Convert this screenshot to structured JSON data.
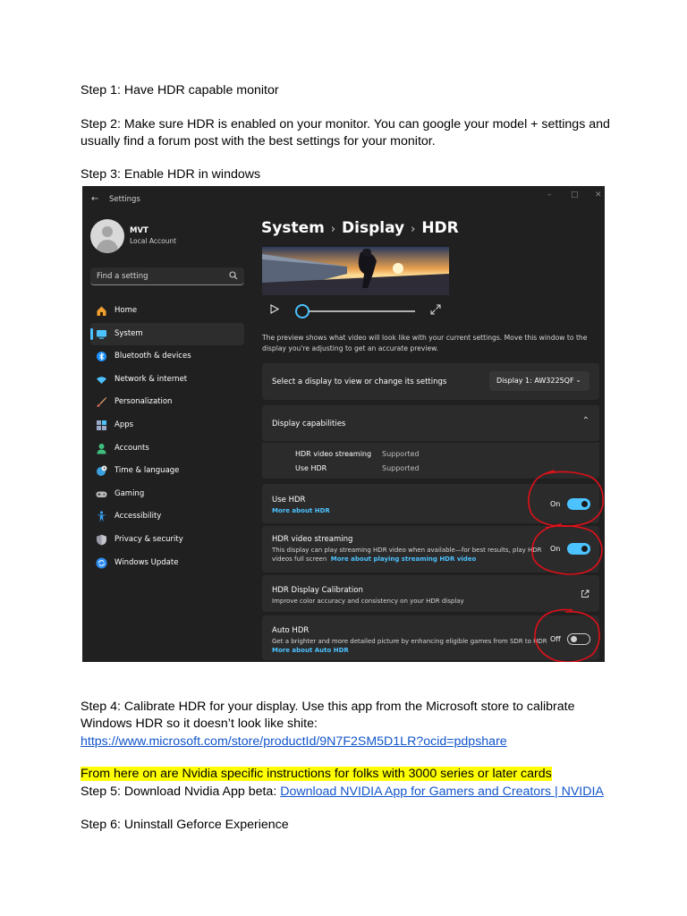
{
  "doc": {
    "step1": "Step 1: Have HDR capable monitor",
    "step2_line1": "Step 2: Make sure HDR is enabled on your monitor. You can google your model + settings and",
    "step2_line2": "usually find a forum post with the best settings for your monitor.",
    "step3": "Step 3: Enable HDR in windows",
    "step4_line1": "Step 4: Calibrate HDR for your display. Use this app from the Microsoft store to calibrate",
    "step4_line2": "Windows HDR so it doesn’t look like shite:",
    "step4_link": "https://www.microsoft.com/store/productId/9N7F2SM5D1LR?ocid=pdpshare",
    "highlight_note": "From here on are Nvidia specific instructions for folks with 3000 series or later cards",
    "step5_prefix": "Step 5: Download Nvidia App beta: ",
    "step5_link": "Download NVIDIA App for Gamers and Creators | NVIDIA",
    "step6": "Step 6: Uninstall Geforce Experience"
  },
  "settings": {
    "window_title": "Settings",
    "window_controls": [
      "–",
      "□",
      "✕"
    ],
    "user": {
      "name": "MVT",
      "account_type": "Local Account"
    },
    "search_placeholder": "Find a setting",
    "nav": [
      {
        "label": "Home",
        "icon": "home-icon",
        "color": "#f0a030"
      },
      {
        "label": "System",
        "icon": "system-icon",
        "color": "#4cc2ff",
        "active": true
      },
      {
        "label": "Bluetooth & devices",
        "icon": "bluetooth-icon",
        "color": "#1e90ff"
      },
      {
        "label": "Network & internet",
        "icon": "wifi-icon",
        "color": "#4cc2ff"
      },
      {
        "label": "Personalization",
        "icon": "brush-icon",
        "color": "#e9a26a"
      },
      {
        "label": "Apps",
        "icon": "apps-icon",
        "color": "#9aa8c8"
      },
      {
        "label": "Accounts",
        "icon": "accounts-icon",
        "color": "#3fbf7f"
      },
      {
        "label": "Time & language",
        "icon": "globe-clock-icon",
        "color": "#3aa0e0"
      },
      {
        "label": "Gaming",
        "icon": "gamepad-icon",
        "color": "#b8b8b8"
      },
      {
        "label": "Accessibility",
        "icon": "accessibility-icon",
        "color": "#3aa0f0"
      },
      {
        "label": "Privacy & security",
        "icon": "shield-icon",
        "color": "#9a9aa8"
      },
      {
        "label": "Windows Update",
        "icon": "update-icon",
        "color": "#2d8cf0"
      }
    ],
    "breadcrumb": [
      "System",
      "Display",
      "HDR"
    ],
    "preview_note": "The preview shows what video will look like with your current settings. Move this window to the display you're adjusting to get an accurate preview.",
    "select_display": {
      "label": "Select a display to view or change its settings",
      "value": "Display 1: AW3225QF"
    },
    "capabilities": {
      "title": "Display capabilities",
      "rows": [
        {
          "name": "HDR video streaming",
          "value": "Supported"
        },
        {
          "name": "Use HDR",
          "value": "Supported"
        }
      ]
    },
    "use_hdr": {
      "title": "Use HDR",
      "link": "More about HDR",
      "state": "On",
      "on": true
    },
    "hdr_streaming": {
      "title": "HDR video streaming",
      "desc1": "This display can play streaming HDR video when available—for best results, play HDR",
      "desc2": "videos full screen",
      "link": "More about playing streaming HDR video",
      "state": "On",
      "on": true
    },
    "calibration": {
      "title": "HDR Display Calibration",
      "desc": "Improve color accuracy and consistency on your HDR display"
    },
    "auto_hdr": {
      "title": "Auto HDR",
      "desc": "Get a brighter and more detailed picture by enhancing eligible games from SDR to HDR",
      "link": "More about Auto HDR",
      "state": "Off",
      "on": false
    },
    "colors": {
      "background": "#202020",
      "card": "#2b2b2b",
      "accent": "#4cc2ff",
      "annotation": "#e0101a"
    }
  }
}
